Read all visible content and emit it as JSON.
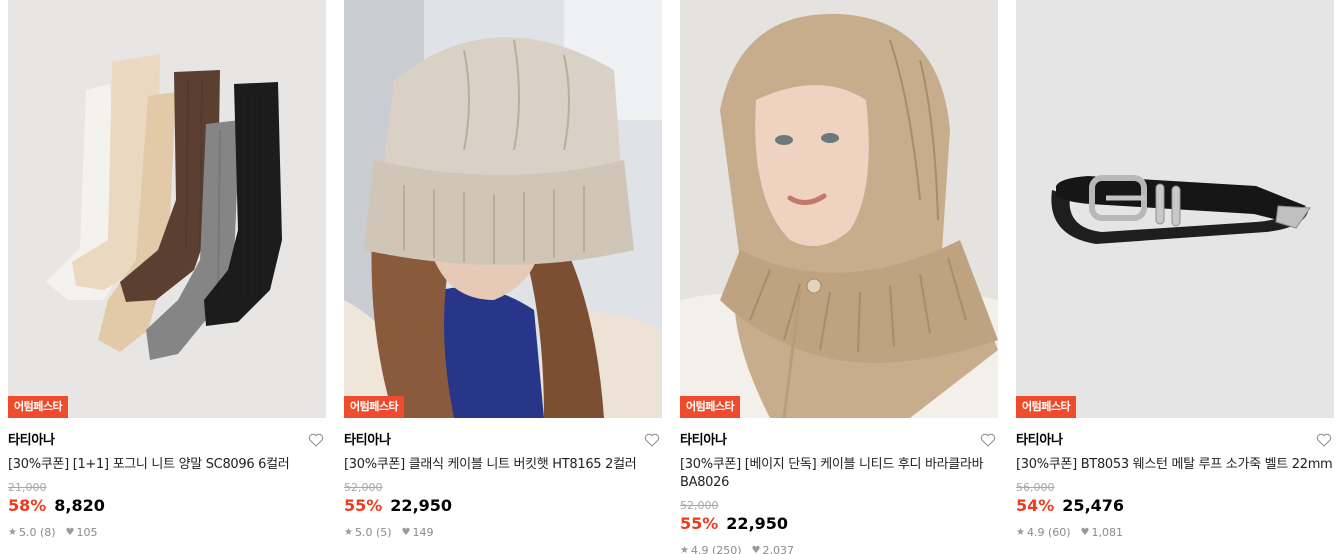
{
  "products": [
    {
      "badge": "어텀페스타",
      "brand": "타티아나",
      "title": "[30%쿠폰] [1+1] 포그니 니트 양말 SC8096 6컬러",
      "original_price": "21,000",
      "discount": "58%",
      "price": "8,820",
      "rating": "5.0 (8)",
      "likes": "105",
      "image_icon": "knit-socks-image"
    },
    {
      "badge": "어텀페스타",
      "brand": "타티아나",
      "title": "[30%쿠폰] 클래식 케이블 니트 버킷햇 HT8165 2컬러",
      "original_price": "52,000",
      "discount": "55%",
      "price": "22,950",
      "rating": "5.0 (5)",
      "likes": "149",
      "image_icon": "knit-bucket-hat-image"
    },
    {
      "badge": "어텀페스타",
      "brand": "타티아나",
      "title": "[30%쿠폰] [베이지 단독] 케이블 니티드 후디 바라클라바 BA8026",
      "original_price": "52,000",
      "discount": "55%",
      "price": "22,950",
      "rating": "4.9 (250)",
      "likes": "2,037",
      "image_icon": "knit-balaclava-image"
    },
    {
      "badge": "어텀페스타",
      "brand": "타티아나",
      "title": "[30%쿠폰] BT8053 웨스턴 메탈 루프 소가죽 벨트 22mm",
      "original_price": "56,000",
      "discount": "54%",
      "price": "25,476",
      "rating": "4.9 (60)",
      "likes": "1,081",
      "image_icon": "leather-belt-image"
    }
  ],
  "colors": {
    "badge_bg": "#ef4c2e",
    "discount": "#ef3a1c",
    "muted": "#8b8b8b"
  }
}
